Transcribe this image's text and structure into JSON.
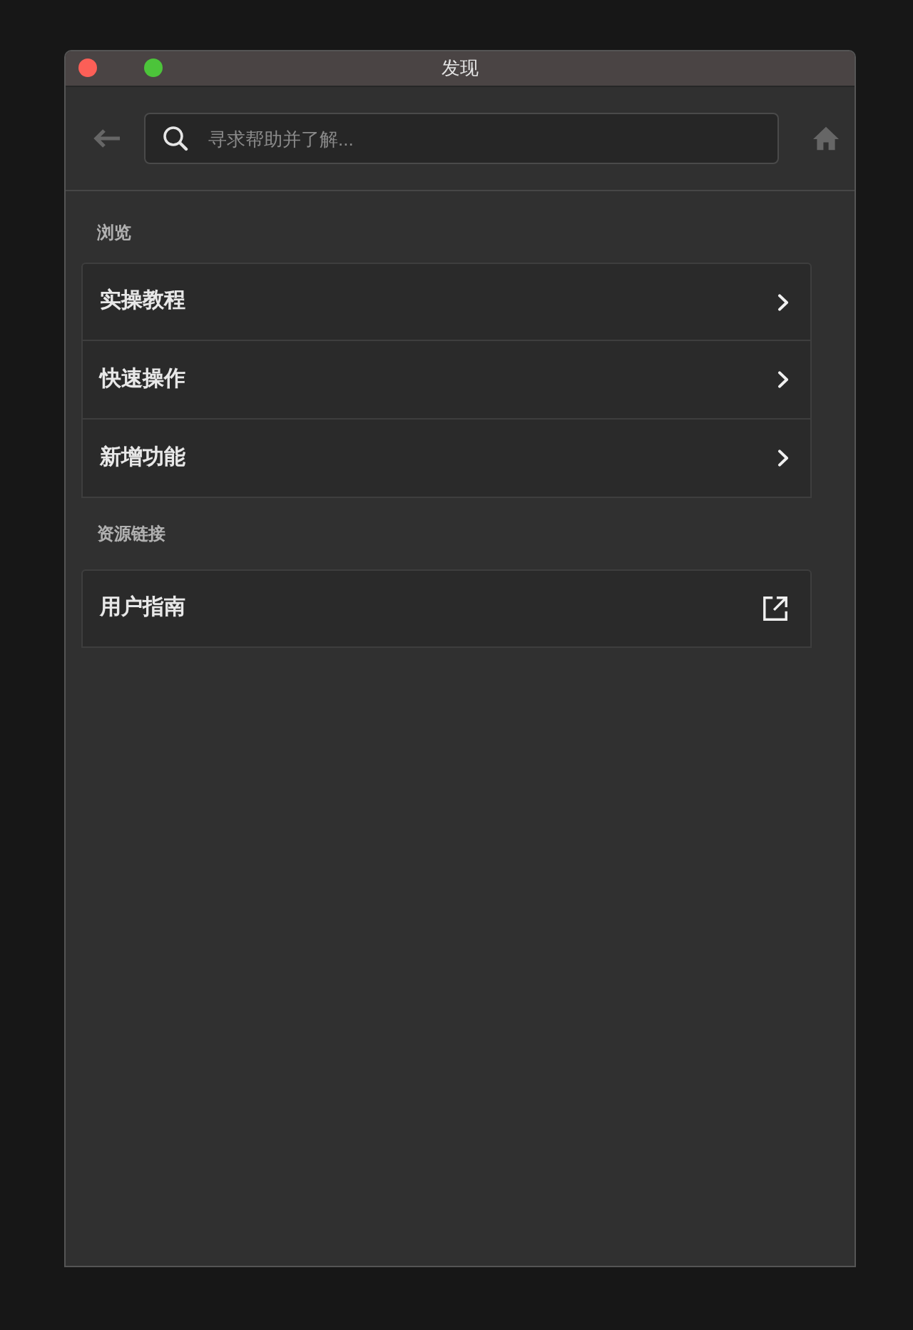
{
  "window": {
    "title": "发现",
    "controls": [
      {
        "kind": "close"
      },
      {
        "kind": "zoom"
      }
    ]
  },
  "toolbar": {
    "back_button": {
      "disabled": true
    },
    "search": {
      "placeholder": "寻求帮助并了解..."
    },
    "home_button": {
      "disabled": true
    }
  },
  "sections": [
    {
      "title": "浏览",
      "items": [
        {
          "label": "实操教程",
          "kind": "page"
        },
        {
          "label": "快速操作",
          "kind": "page"
        },
        {
          "label": "新增功能",
          "kind": "page"
        }
      ]
    },
    {
      "title": "资源链接",
      "items": [
        {
          "label": "用户指南",
          "kind": "external"
        }
      ]
    }
  ]
}
